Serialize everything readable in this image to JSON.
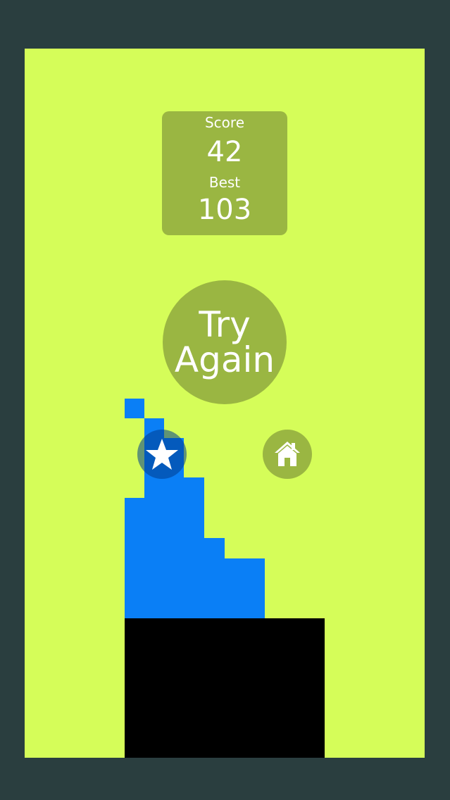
{
  "scoreboard": {
    "score_label": "Score",
    "score_value": "42",
    "best_label": "Best",
    "best_value": "103"
  },
  "try_again": {
    "line1": "Try",
    "line2": "Again"
  },
  "icons": {
    "rate": "star-icon",
    "home": "home-icon"
  },
  "colors": {
    "background": "#d5fd59",
    "frame": "#2a3e3f",
    "panel": "#9ab642",
    "blocks": "#0a7ff6",
    "platform": "#000000"
  }
}
